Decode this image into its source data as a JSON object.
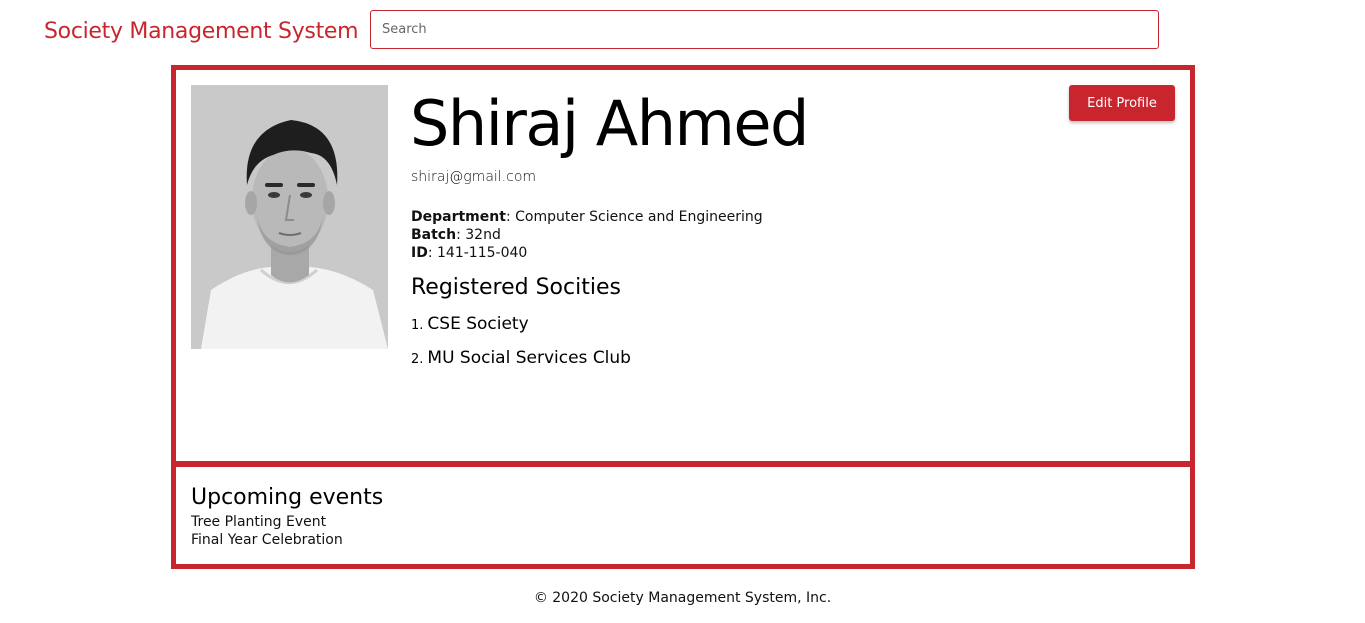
{
  "header": {
    "brand": "Society Management System",
    "search_placeholder": "Search",
    "search_value": ""
  },
  "profile": {
    "name": "Shiraj Ahmed",
    "email": "shiraj@gmail.com",
    "edit_button_label": "Edit Profile",
    "details": [
      {
        "key": "Department",
        "value": "Computer Science and Engineering"
      },
      {
        "key": "Batch",
        "value": "32nd"
      },
      {
        "key": "ID",
        "value": "141-115-040"
      }
    ],
    "registered_title": "Registered Socities",
    "societies": [
      {
        "num": "1.",
        "name": "CSE Society"
      },
      {
        "num": "2.",
        "name": "MU Social Services Club"
      }
    ]
  },
  "events": {
    "title": "Upcoming events",
    "items": [
      "Tree Planting Event",
      "Final Year Celebration"
    ]
  },
  "footer": {
    "text": "© 2020 Society Management System, Inc."
  },
  "colors": {
    "accent": "#c9252f",
    "text": "#111111",
    "background": "#ffffff"
  },
  "icons": {
    "avatar": "profile-photo"
  }
}
